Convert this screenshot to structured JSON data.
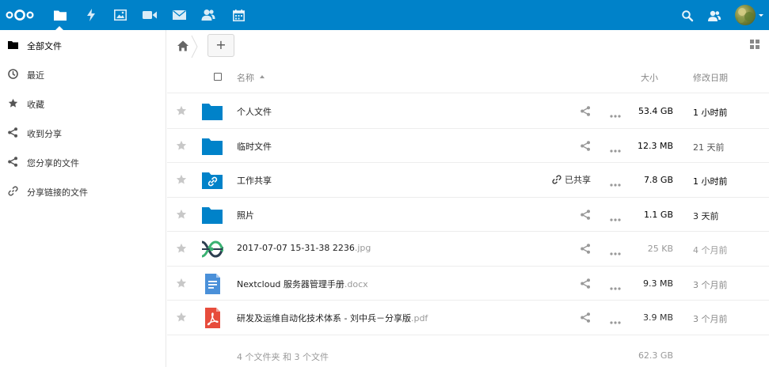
{
  "header": {
    "apps": [
      {
        "name": "files-icon",
        "active": true
      },
      {
        "name": "activity-icon"
      },
      {
        "name": "gallery-icon"
      },
      {
        "name": "video-icon"
      },
      {
        "name": "mail-icon"
      },
      {
        "name": "contacts-icon"
      },
      {
        "name": "calendar-icon"
      }
    ],
    "brand_color": "#0082c9"
  },
  "sidebar": {
    "items": [
      {
        "label": "全部文件",
        "icon": "folder-icon",
        "active": true
      },
      {
        "label": "最近",
        "icon": "clock-icon"
      },
      {
        "label": "收藏",
        "icon": "star-icon"
      },
      {
        "label": "收到分享",
        "icon": "share-icon"
      },
      {
        "label": "您分享的文件",
        "icon": "share-icon"
      },
      {
        "label": "分享链接的文件",
        "icon": "link-icon"
      }
    ]
  },
  "controls": {
    "new_label": "+"
  },
  "table": {
    "headers": {
      "name": "名称",
      "size": "大小",
      "modified": "修改日期"
    },
    "rows": [
      {
        "name": "个人文件",
        "ext": "",
        "type": "folder",
        "size": "53.4 GB",
        "size_color": "#000",
        "date": "1 小时前",
        "date_color": "#000",
        "shared": ""
      },
      {
        "name": "临时文件",
        "ext": "",
        "type": "folder",
        "size": "12.3 MB",
        "size_color": "#000",
        "date": "21 天前",
        "date_color": "#555",
        "shared": ""
      },
      {
        "name": "工作共享",
        "ext": "",
        "type": "folder-link",
        "size": "7.8 GB",
        "size_color": "#000",
        "date": "1 小时前",
        "date_color": "#000",
        "shared": "已共享"
      },
      {
        "name": "照片",
        "ext": "",
        "type": "folder",
        "size": "1.1 GB",
        "size_color": "#000",
        "date": "3 天前",
        "date_color": "#222",
        "shared": ""
      },
      {
        "name": "2017-07-07 15-31-38 2236",
        "ext": ".jpg",
        "type": "image",
        "size": "25 KB",
        "size_color": "#999",
        "date": "4 个月前",
        "date_color": "#999",
        "shared": ""
      },
      {
        "name": "Nextcloud 服务器管理手册",
        "ext": ".docx",
        "type": "document",
        "size": "9.3 MB",
        "size_color": "#222",
        "date": "3 个月前",
        "date_color": "#888",
        "shared": ""
      },
      {
        "name": "研发及运维自动化技术体系 - 刘中兵－分享版",
        "ext": ".pdf",
        "type": "pdf",
        "size": "3.9 MB",
        "size_color": "#333",
        "date": "3 个月前",
        "date_color": "#888",
        "shared": ""
      }
    ]
  },
  "summary": {
    "text": "4 个文件夹 和 3 个文件",
    "total_size": "62.3 GB"
  }
}
